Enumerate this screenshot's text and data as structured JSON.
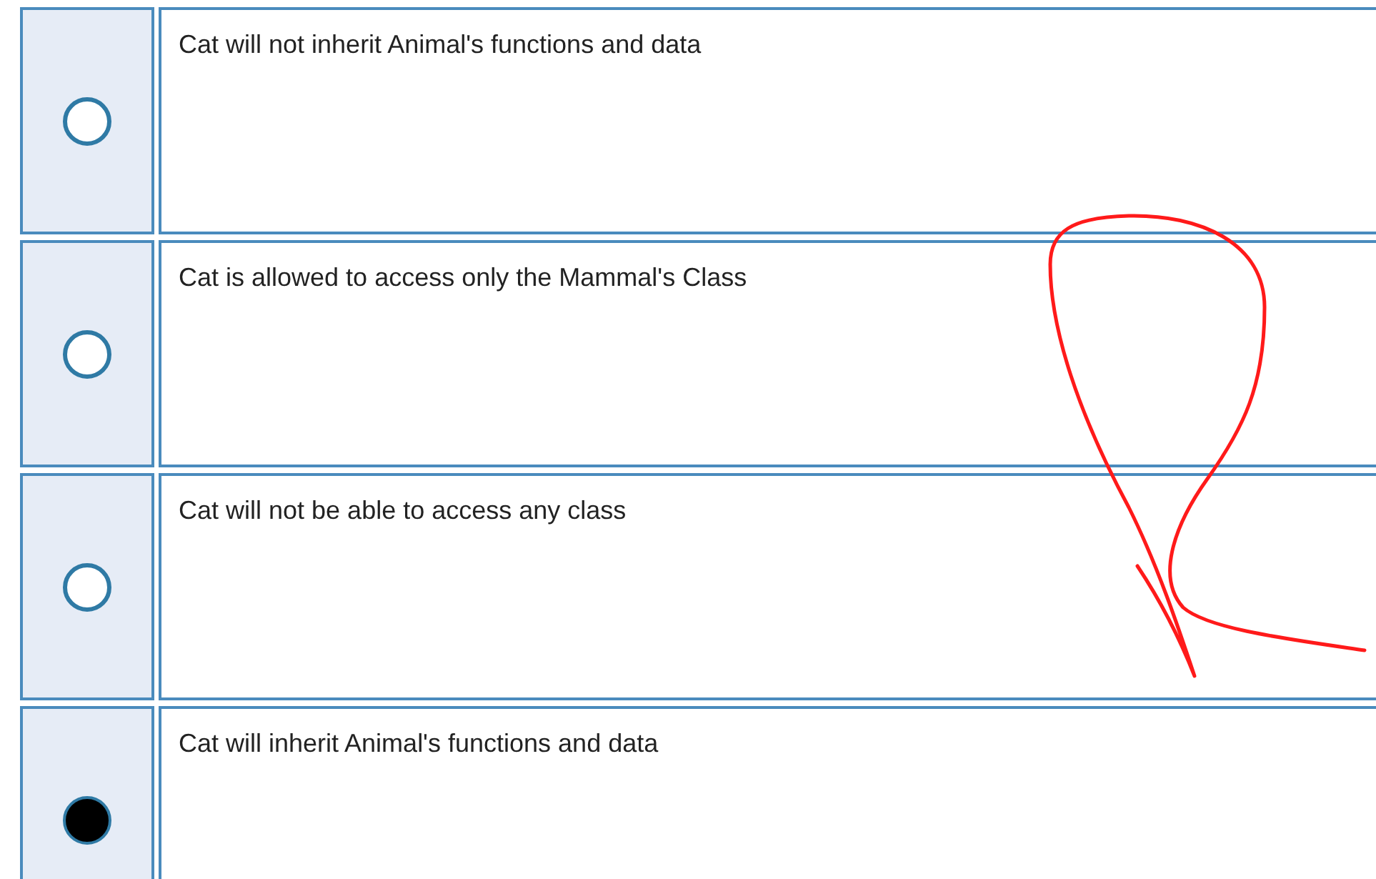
{
  "options": [
    {
      "text": "Cat will not inherit Animal's functions and data",
      "selected": false
    },
    {
      "text": "Cat is allowed to access only the Mammal's Class",
      "selected": false
    },
    {
      "text": "Cat will not be able to access any class",
      "selected": false
    },
    {
      "text": "Cat will inherit Animal's functions and data",
      "selected": true
    }
  ]
}
